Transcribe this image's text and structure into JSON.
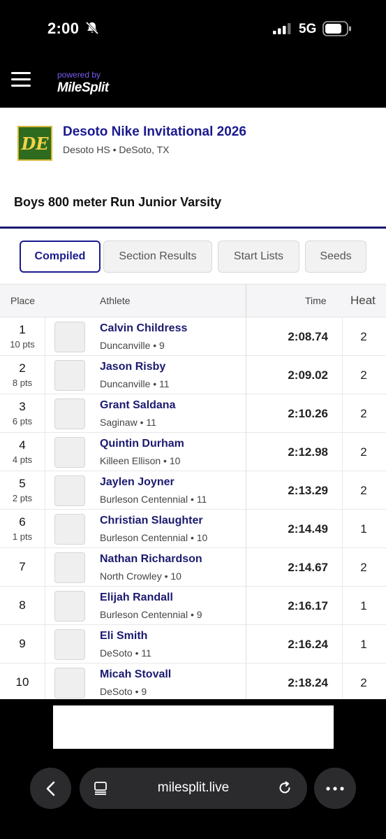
{
  "status_bar": {
    "time": "2:00",
    "network": "5G"
  },
  "header": {
    "powered_by": "powered by",
    "brand": "MileSplit"
  },
  "meet": {
    "logo_text": "DE",
    "title": "Desoto Nike Invitational 2026",
    "location": "Desoto HS • DeSoto, TX"
  },
  "event": {
    "title": "Boys 800 meter Run Junior Varsity"
  },
  "tabs": [
    {
      "label": "Compiled",
      "active": true
    },
    {
      "label": "Section Results",
      "active": false
    },
    {
      "label": "Start Lists",
      "active": false
    },
    {
      "label": "Seeds",
      "active": false
    }
  ],
  "table": {
    "headers": {
      "place": "Place",
      "athlete": "Athlete",
      "time": "Time",
      "heat": "Heat"
    },
    "rows": [
      {
        "place": "1",
        "pts": "10 pts",
        "name": "Calvin Childress",
        "sub": "Duncanville • 9",
        "time": "2:08.74",
        "heat": "2"
      },
      {
        "place": "2",
        "pts": "8 pts",
        "name": "Jason Risby",
        "sub": "Duncanville • 11",
        "time": "2:09.02",
        "heat": "2"
      },
      {
        "place": "3",
        "pts": "6 pts",
        "name": "Grant Saldana",
        "sub": "Saginaw • 11",
        "time": "2:10.26",
        "heat": "2"
      },
      {
        "place": "4",
        "pts": "4 pts",
        "name": "Quintin Durham",
        "sub": "Killeen Ellison • 10",
        "time": "2:12.98",
        "heat": "2"
      },
      {
        "place": "5",
        "pts": "2 pts",
        "name": "Jaylen Joyner",
        "sub": "Burleson Centennial • 11",
        "time": "2:13.29",
        "heat": "2"
      },
      {
        "place": "6",
        "pts": "1 pts",
        "name": "Christian Slaughter",
        "sub": "Burleson Centennial • 10",
        "time": "2:14.49",
        "heat": "1"
      },
      {
        "place": "7",
        "pts": "",
        "name": "Nathan Richardson",
        "sub": "North Crowley • 10",
        "time": "2:14.67",
        "heat": "2"
      },
      {
        "place": "8",
        "pts": "",
        "name": "Elijah Randall",
        "sub": "Burleson Centennial • 9",
        "time": "2:16.17",
        "heat": "1"
      },
      {
        "place": "9",
        "pts": "",
        "name": "Eli Smith",
        "sub": "DeSoto • 11",
        "time": "2:16.24",
        "heat": "1"
      },
      {
        "place": "10",
        "pts": "",
        "name": "Micah Stovall",
        "sub": "DeSoto • 9",
        "time": "2:18.24",
        "heat": "2"
      }
    ]
  },
  "browser": {
    "url": "milesplit.live"
  },
  "colors": {
    "accent": "#1b1a8f",
    "brand_purple": "#7a5cf0",
    "logo_green": "#2e6b1e",
    "logo_gold": "#f4d34a"
  }
}
